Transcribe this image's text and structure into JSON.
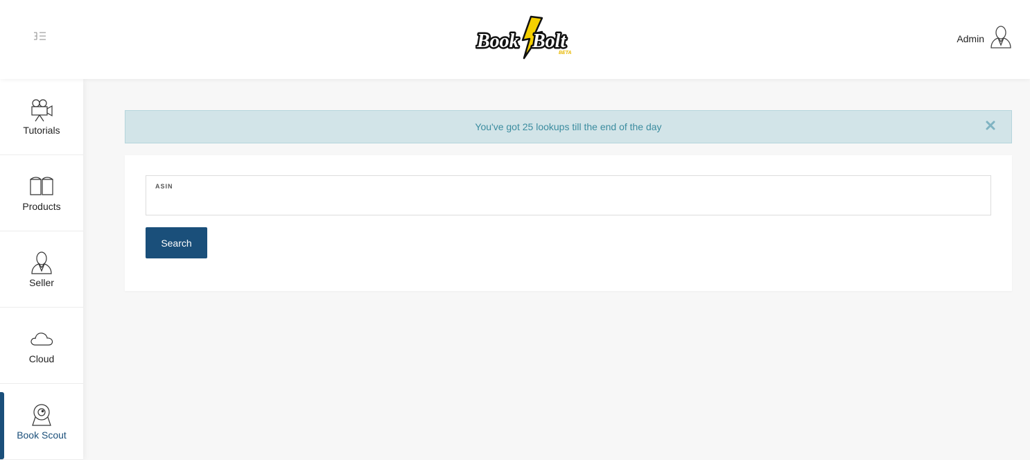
{
  "header": {
    "logo_text": "Book Bolt",
    "logo_badge": "BETA",
    "user_label": "Admin"
  },
  "sidebar": {
    "items": [
      {
        "label": "Tutorials",
        "icon": "video-camera-icon"
      },
      {
        "label": "Products",
        "icon": "book-icon"
      },
      {
        "label": "Seller",
        "icon": "user-icon"
      },
      {
        "label": "Cloud",
        "icon": "cloud-icon"
      },
      {
        "label": "Book Scout",
        "icon": "webcam-icon",
        "active": true
      }
    ]
  },
  "alert": {
    "message": "You've got 25 lookups till the end of the day"
  },
  "search": {
    "field_label": "ASIN",
    "value": "",
    "button_label": "Search"
  },
  "colors": {
    "accent": "#1a4f7a",
    "alert_bg": "#d2e4e8",
    "alert_text": "#3b8c9f",
    "logo_bolt": "#f5d000"
  }
}
